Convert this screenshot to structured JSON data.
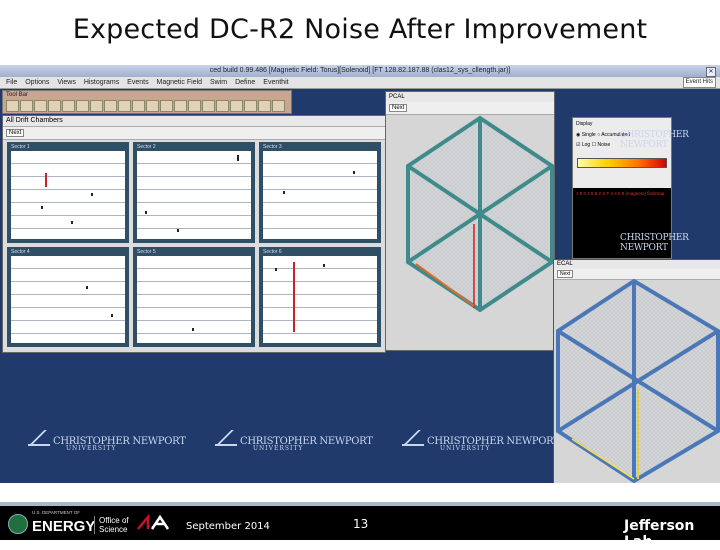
{
  "slide": {
    "title": "Expected DC-R2 Noise After Improvement",
    "footer_date": "September 2014",
    "page_number": "13"
  },
  "app": {
    "window_title": "ced build 0.99.486  [Magnetic Field: Torus][Solenoid] [FT 128.82.187.88 (clas12_sys_cllength.jar)]",
    "menu": [
      "File",
      "Options",
      "Views",
      "Histograms",
      "Events",
      "Magnetic Field",
      "Swim",
      "Define",
      "Eventhit"
    ],
    "event_button": "Event Hits",
    "toolbar_label": "Tool Bar",
    "dc_view_title": "All Drift Chambers",
    "dc_next": "Next",
    "sectors": [
      "Sector 1",
      "Sector 2",
      "Sector 3",
      "Sector 4",
      "Sector 5",
      "Sector 6"
    ],
    "hex_view_title": "PCAL",
    "hex_next": "Next",
    "panel_title": "Display",
    "panel_options": [
      "Single",
      "Accumulated",
      "Log",
      "Noise"
    ],
    "panel_text": "1 5 0 4 8 5 2 S F 4 4 5 8  (magneto) fieldmap",
    "ec_view_title": "ECAL",
    "ec_next": "Next",
    "watermark_name": "CHRISTOPHER NEWPORT",
    "watermark_sub": "UNIVERSITY"
  },
  "footer": {
    "dept": "U.S. DEPARTMENT OF",
    "energy": "ENERGY",
    "office_line1": "Office of",
    "office_line2": "Science",
    "lab": "Jefferson Lab"
  },
  "colors": {
    "desktop": "#203a6b",
    "hex_frame": "#3f8a8a",
    "ec_frame": "#4a77b8",
    "hit_red": "#cc2222"
  }
}
